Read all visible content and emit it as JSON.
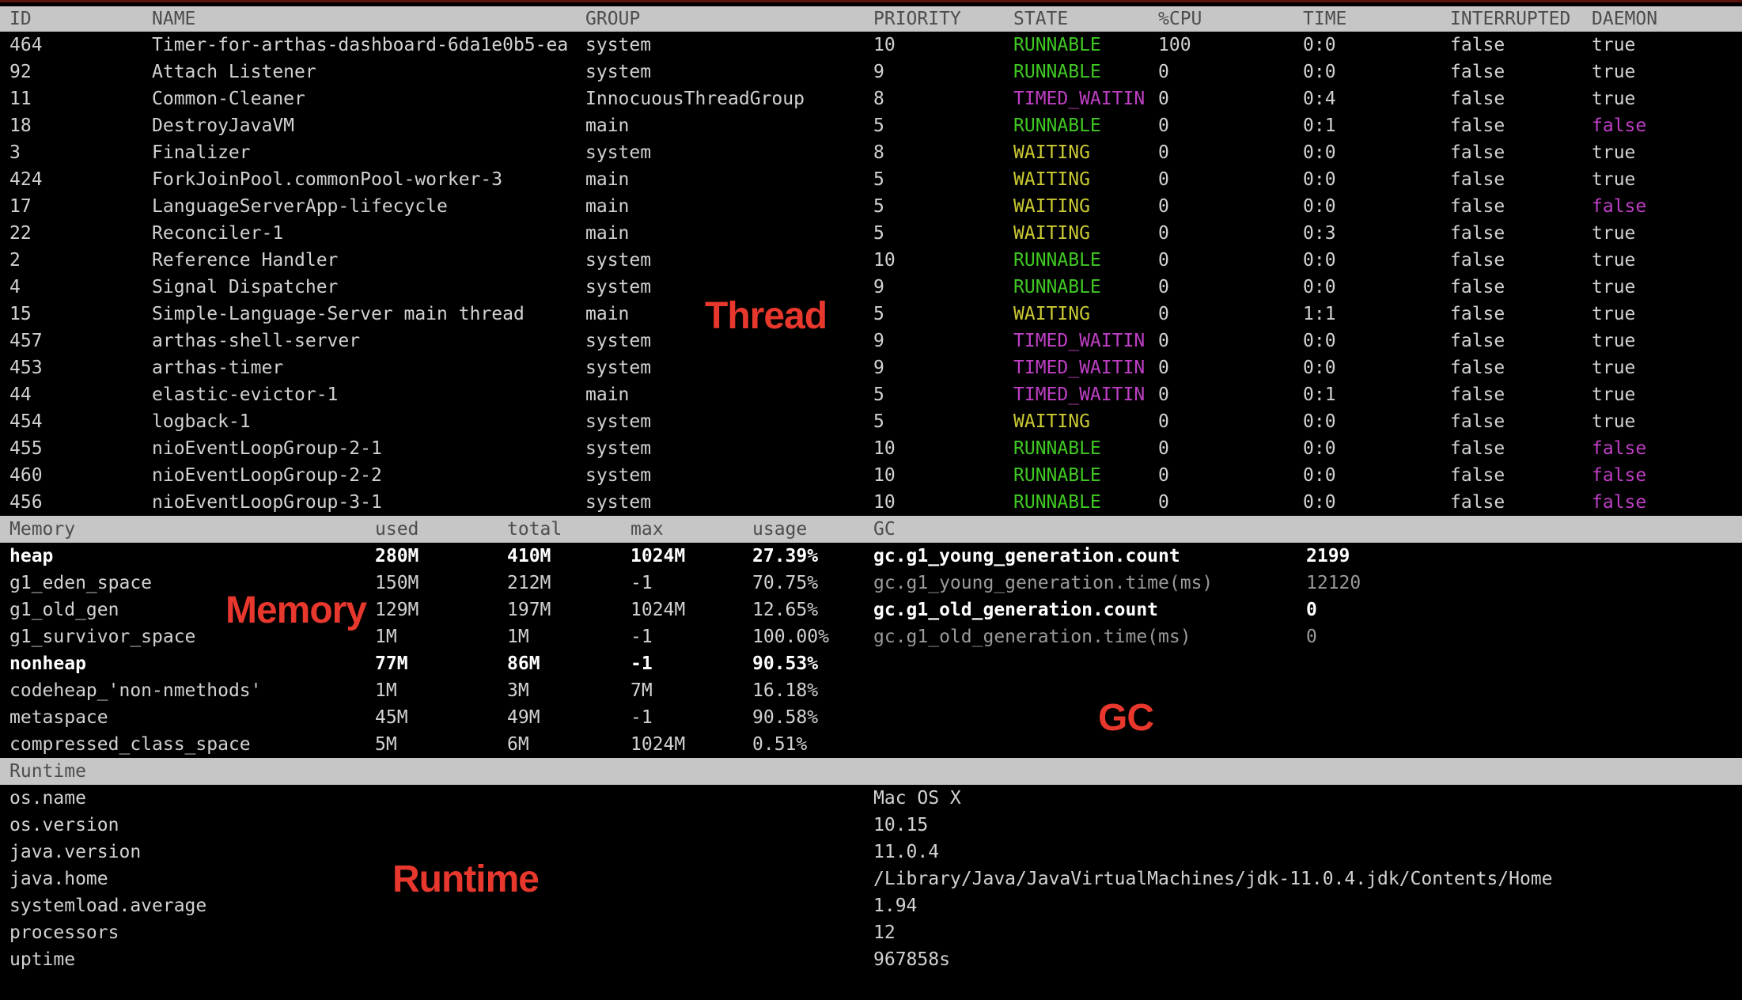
{
  "colors": {
    "background": "#000000",
    "section_bar": "#c6c6c6",
    "section_bar_text": "#4d4d4d",
    "text_normal": "#d2d2d2",
    "text_bold": "#ffffff",
    "text_dim": "#9a9a9a",
    "state_runnable": "#3fc822",
    "state_waiting": "#cbca33",
    "state_timed_waiting": "#bf3fc5",
    "annotation_red": "#e8382d",
    "top_line": "#5a130c"
  },
  "annotations": {
    "thread": "Thread",
    "memory": "Memory",
    "gc": "GC",
    "runtime": "Runtime"
  },
  "thread_table": {
    "headers": [
      "ID",
      "NAME",
      "GROUP",
      "PRIORITY",
      "STATE",
      "%CPU",
      "TIME",
      "INTERRUPTED",
      "DAEMON"
    ],
    "rows": [
      {
        "id": "464",
        "name": "Timer-for-arthas-dashboard-6da1e0b5-ea",
        "group": "system",
        "priority": "10",
        "state": "RUNNABLE",
        "cpu": "100",
        "time": "0:0",
        "interrupted": "false",
        "daemon": "true"
      },
      {
        "id": "92",
        "name": "Attach Listener",
        "group": "system",
        "priority": "9",
        "state": "RUNNABLE",
        "cpu": "0",
        "time": "0:0",
        "interrupted": "false",
        "daemon": "true"
      },
      {
        "id": "11",
        "name": "Common-Cleaner",
        "group": "InnocuousThreadGroup",
        "priority": "8",
        "state": "TIMED_WAITIN",
        "cpu": "0",
        "time": "0:4",
        "interrupted": "false",
        "daemon": "true"
      },
      {
        "id": "18",
        "name": "DestroyJavaVM",
        "group": "main",
        "priority": "5",
        "state": "RUNNABLE",
        "cpu": "0",
        "time": "0:1",
        "interrupted": "false",
        "daemon": "false"
      },
      {
        "id": "3",
        "name": "Finalizer",
        "group": "system",
        "priority": "8",
        "state": "WAITING",
        "cpu": "0",
        "time": "0:0",
        "interrupted": "false",
        "daemon": "true"
      },
      {
        "id": "424",
        "name": "ForkJoinPool.commonPool-worker-3",
        "group": "main",
        "priority": "5",
        "state": "WAITING",
        "cpu": "0",
        "time": "0:0",
        "interrupted": "false",
        "daemon": "true"
      },
      {
        "id": "17",
        "name": "LanguageServerApp-lifecycle",
        "group": "main",
        "priority": "5",
        "state": "WAITING",
        "cpu": "0",
        "time": "0:0",
        "interrupted": "false",
        "daemon": "false"
      },
      {
        "id": "22",
        "name": "Reconciler-1",
        "group": "main",
        "priority": "5",
        "state": "WAITING",
        "cpu": "0",
        "time": "0:3",
        "interrupted": "false",
        "daemon": "true"
      },
      {
        "id": "2",
        "name": "Reference Handler",
        "group": "system",
        "priority": "10",
        "state": "RUNNABLE",
        "cpu": "0",
        "time": "0:0",
        "interrupted": "false",
        "daemon": "true"
      },
      {
        "id": "4",
        "name": "Signal Dispatcher",
        "group": "system",
        "priority": "9",
        "state": "RUNNABLE",
        "cpu": "0",
        "time": "0:0",
        "interrupted": "false",
        "daemon": "true"
      },
      {
        "id": "15",
        "name": "Simple-Language-Server main thread",
        "group": "main",
        "priority": "5",
        "state": "WAITING",
        "cpu": "0",
        "time": "1:1",
        "interrupted": "false",
        "daemon": "true"
      },
      {
        "id": "457",
        "name": "arthas-shell-server",
        "group": "system",
        "priority": "9",
        "state": "TIMED_WAITIN",
        "cpu": "0",
        "time": "0:0",
        "interrupted": "false",
        "daemon": "true"
      },
      {
        "id": "453",
        "name": "arthas-timer",
        "group": "system",
        "priority": "9",
        "state": "TIMED_WAITIN",
        "cpu": "0",
        "time": "0:0",
        "interrupted": "false",
        "daemon": "true"
      },
      {
        "id": "44",
        "name": "elastic-evictor-1",
        "group": "main",
        "priority": "5",
        "state": "TIMED_WAITIN",
        "cpu": "0",
        "time": "0:1",
        "interrupted": "false",
        "daemon": "true"
      },
      {
        "id": "454",
        "name": "logback-1",
        "group": "system",
        "priority": "5",
        "state": "WAITING",
        "cpu": "0",
        "time": "0:0",
        "interrupted": "false",
        "daemon": "true"
      },
      {
        "id": "455",
        "name": "nioEventLoopGroup-2-1",
        "group": "system",
        "priority": "10",
        "state": "RUNNABLE",
        "cpu": "0",
        "time": "0:0",
        "interrupted": "false",
        "daemon": "false"
      },
      {
        "id": "460",
        "name": "nioEventLoopGroup-2-2",
        "group": "system",
        "priority": "10",
        "state": "RUNNABLE",
        "cpu": "0",
        "time": "0:0",
        "interrupted": "false",
        "daemon": "false"
      },
      {
        "id": "456",
        "name": "nioEventLoopGroup-3-1",
        "group": "system",
        "priority": "10",
        "state": "RUNNABLE",
        "cpu": "0",
        "time": "0:0",
        "interrupted": "false",
        "daemon": "false"
      }
    ]
  },
  "memory_table": {
    "headers": {
      "name": "Memory",
      "used": "used",
      "total": "total",
      "max": "max",
      "usage": "usage"
    },
    "rows": [
      {
        "name": "heap",
        "used": "280M",
        "total": "410M",
        "max": "1024M",
        "usage": "27.39%",
        "bold": true
      },
      {
        "name": "g1_eden_space",
        "used": "150M",
        "total": "212M",
        "max": "-1",
        "usage": "70.75%",
        "bold": false
      },
      {
        "name": "g1_old_gen",
        "used": "129M",
        "total": "197M",
        "max": "1024M",
        "usage": "12.65%",
        "bold": false
      },
      {
        "name": "g1_survivor_space",
        "used": "1M",
        "total": "1M",
        "max": "-1",
        "usage": "100.00%",
        "bold": false
      },
      {
        "name": "nonheap",
        "used": "77M",
        "total": "86M",
        "max": "-1",
        "usage": "90.53%",
        "bold": true
      },
      {
        "name": "codeheap_'non-nmethods'",
        "used": "1M",
        "total": "3M",
        "max": "7M",
        "usage": "16.18%",
        "bold": false
      },
      {
        "name": "metaspace",
        "used": "45M",
        "total": "49M",
        "max": "-1",
        "usage": "90.58%",
        "bold": false
      },
      {
        "name": "compressed_class_space",
        "used": "5M",
        "total": "6M",
        "max": "1024M",
        "usage": "0.51%",
        "bold": false
      }
    ]
  },
  "gc_table": {
    "header": "GC",
    "rows": [
      {
        "name": "gc.g1_young_generation.count",
        "value": "2199",
        "bold": true
      },
      {
        "name": "gc.g1_young_generation.time(ms)",
        "value": "12120",
        "bold": false
      },
      {
        "name": "gc.g1_old_generation.count",
        "value": "0",
        "bold": true
      },
      {
        "name": "gc.g1_old_generation.time(ms)",
        "value": "0",
        "bold": false
      }
    ]
  },
  "runtime_table": {
    "header": "Runtime",
    "rows": [
      {
        "name": "os.name",
        "value": "Mac OS X"
      },
      {
        "name": "os.version",
        "value": "10.15"
      },
      {
        "name": "java.version",
        "value": "11.0.4"
      },
      {
        "name": "java.home",
        "value": "/Library/Java/JavaVirtualMachines/jdk-11.0.4.jdk/Contents/Home"
      },
      {
        "name": "systemload.average",
        "value": "1.94"
      },
      {
        "name": "processors",
        "value": "12"
      },
      {
        "name": "uptime",
        "value": "967858s"
      }
    ]
  }
}
